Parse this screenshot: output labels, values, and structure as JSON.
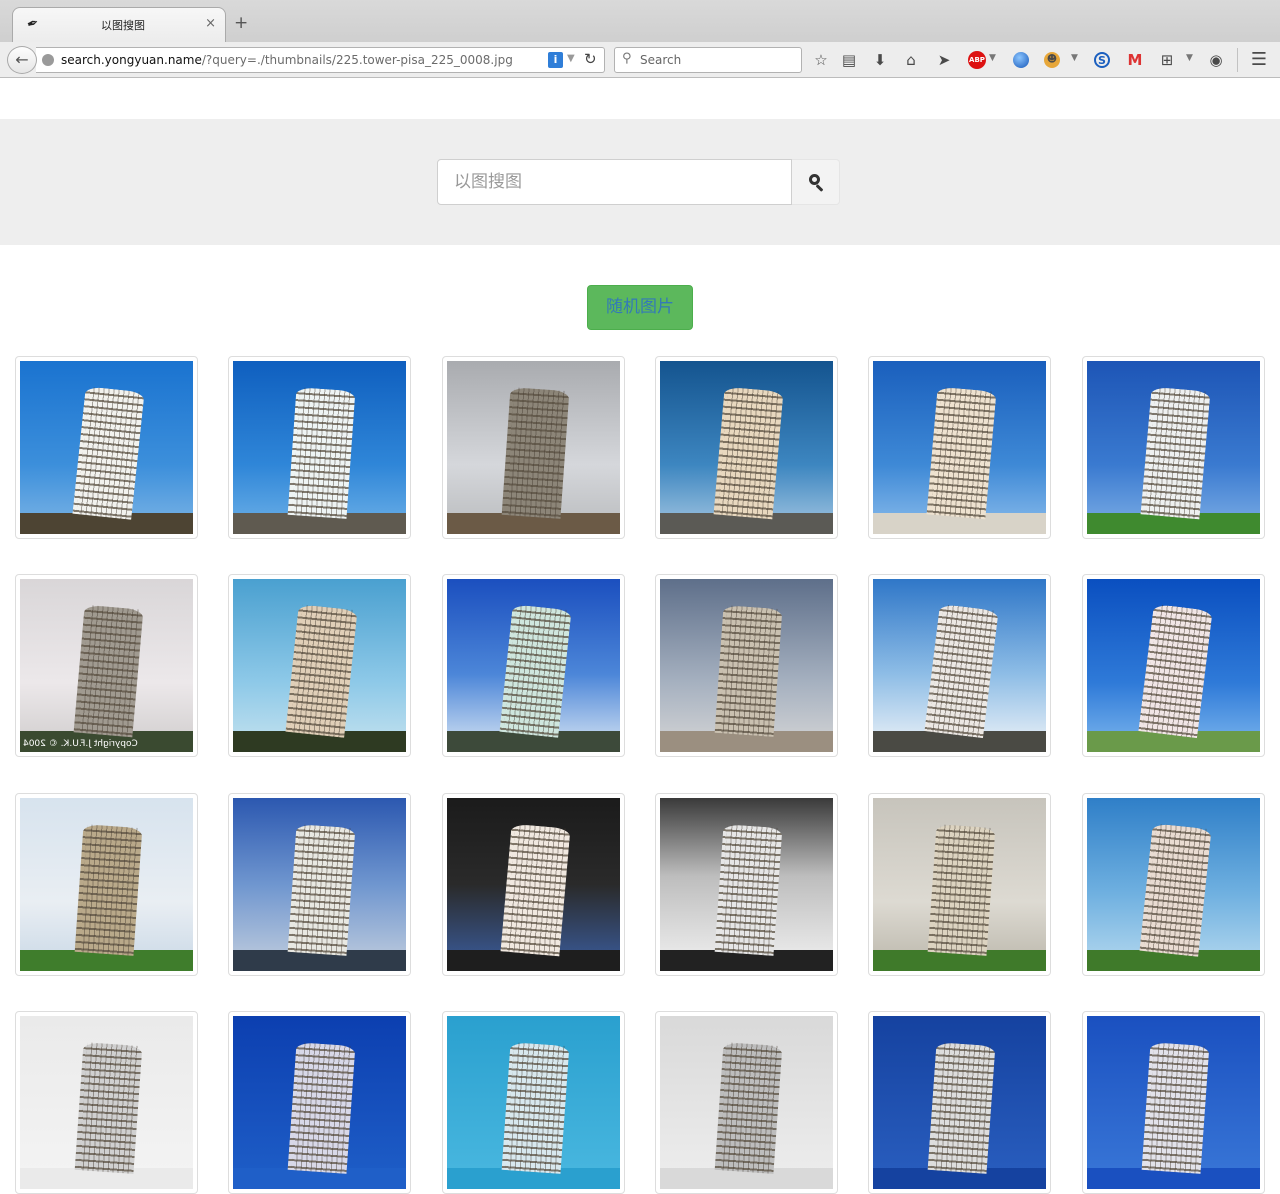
{
  "browser": {
    "tab_title": "以图搜图",
    "tab_close": "×",
    "new_tab": "+",
    "url_host": "search.yongyuan.name",
    "url_path": "/?query=./thumbnails/225.tower-pisa_225_0008.jpg",
    "search_placeholder": "Search",
    "toolbar_icons": [
      "bookmark-star-icon",
      "reading-list-icon",
      "download-icon",
      "home-icon",
      "send-icon",
      "adblock-plus-icon",
      "blue-ball-icon",
      "greasemonkey-icon",
      "s-icon",
      "gmail-icon",
      "crop-icon",
      "chat-icon",
      "menu-icon"
    ]
  },
  "search": {
    "placeholder": "以图搜图"
  },
  "random_button": "随机图片",
  "colors": {
    "jumbotron_bg": "#eeeeee",
    "random_button_bg": "#5cb85c",
    "random_button_text": "#337ab7"
  },
  "results": [
    {
      "sky": "linear-gradient(#1a73d0,#3c8fdb 60%,#7fb6e6)",
      "tower": "#f2f2ee",
      "ground": "#4d4433",
      "tilt": 6
    },
    {
      "sky": "linear-gradient(#0f5fbf,#2f86d8 60%,#6fb2e8)",
      "tower": "#eef4f4",
      "ground": "#5f5a50",
      "tilt": 4
    },
    {
      "sky": "linear-gradient(#a9abaf,#d5d7db 60%,#b9bbbd)",
      "tower": "#8c8578",
      "ground": "#6b5a46",
      "tilt": 4
    },
    {
      "sky": "linear-gradient(#14548f,#3d86c0 60%,#a8c9e3)",
      "tower": "#e8d8bf",
      "ground": "#5b5a55",
      "tilt": 5
    },
    {
      "sky": "linear-gradient(#1a5fbd,#3e89d6 60%,#8cbdec)",
      "tower": "#eee2d0",
      "ground": "#d8d3c8",
      "tilt": 5
    },
    {
      "sky": "linear-gradient(#1d55b6,#3a7ad0 60%,#7fb0e6)",
      "tower": "#eef0f0",
      "ground": "#3f8a2f",
      "tilt": 5
    },
    {
      "sky": "linear-gradient(#d9d6d8,#ece8ea 60%,#cfcccc)",
      "tower": "#a09a90",
      "ground": "#3a4a30",
      "tilt": 5
    },
    {
      "sky": "linear-gradient(#4aa0d0,#8ec9e8 60%,#c6e3ef)",
      "tower": "#e0cfb8",
      "ground": "#2e3a22",
      "tilt": 6
    },
    {
      "sky": "linear-gradient(#1b4fbf,#4c86d8 55%,#d9e6f4)",
      "tower": "#cfe6de",
      "ground": "#3d4a3a",
      "tilt": 6
    },
    {
      "sky": "linear-gradient(#5e6f8a,#a6b1c0 60%,#d6d6d6)",
      "tower": "#c9c0b0",
      "ground": "#9b8f80",
      "tilt": 4
    },
    {
      "sky": "linear-gradient(#2f77c8,#8ebde6 55%,#f0f4f8)",
      "tower": "#ece8e4",
      "ground": "#4a4a44",
      "tilt": 7
    },
    {
      "sky": "linear-gradient(#0a4fc0,#2f7ad8 60%,#7eb8ee)",
      "tower": "#f1e6e6",
      "ground": "#6a9a4a",
      "tilt": 7
    },
    {
      "sky": "linear-gradient(#d7e3ee,#e9eef3 60%,#c9d8e6)",
      "tower": "#b9a98a",
      "ground": "#3f7d2c",
      "tilt": 4
    },
    {
      "sky": "linear-gradient(#2c58b0,#6f96cf 50%,#c4cfde)",
      "tower": "#e8e8e2",
      "ground": "#2f3b4a",
      "tilt": 4
    },
    {
      "sky": "linear-gradient(#1b1b1b,#2a2a2a 50%,#3b5ea0)",
      "tower": "#f0e8e0",
      "ground": "#1e1e1e",
      "tilt": 5
    },
    {
      "sky": "linear-gradient(#3a3a3a,#bdbdbd 45%,#f2f2f2)",
      "tower": "#e6e6e6",
      "ground": "#222",
      "tilt": 4
    },
    {
      "sky": "linear-gradient(#c7c4bc,#dddad2 60%,#bab6aa)",
      "tower": "#dcd3c0",
      "ground": "#3f7a2a",
      "tilt": 4
    },
    {
      "sky": "linear-gradient(#2f7fc8,#6fb0e0 55%,#b7daef)",
      "tower": "#e9dcd2",
      "ground": "#3f7a2a",
      "tilt": 6
    },
    {
      "sky": "linear-gradient(#eaeaea,#f4f4f4)",
      "tower": "#d0d0d0",
      "ground": "#eaeaea",
      "tilt": 4
    },
    {
      "sky": "linear-gradient(#0c3fb0,#1f5fc8)",
      "tower": "#d8d8e8",
      "ground": "#1f5fc8",
      "tilt": 4
    },
    {
      "sky": "linear-gradient(#2aa0cf,#4ab8e0)",
      "tower": "#d8e8ee",
      "ground": "#2aa0cf",
      "tilt": 4
    },
    {
      "sky": "linear-gradient(#d9d9d9,#eeeeee)",
      "tower": "#bdbdbd",
      "ground": "#d9d9d9",
      "tilt": 4
    },
    {
      "sky": "linear-gradient(#1542a0,#2a5fc0)",
      "tower": "#ddd",
      "ground": "#1542a0",
      "tilt": 4
    },
    {
      "sky": "linear-gradient(#1a50c0,#3a78d8)",
      "tower": "#e2e2ea",
      "ground": "#1a50c0",
      "tilt": 4
    }
  ],
  "watermark_text": "Copyright J.F.U.K. © 2004"
}
